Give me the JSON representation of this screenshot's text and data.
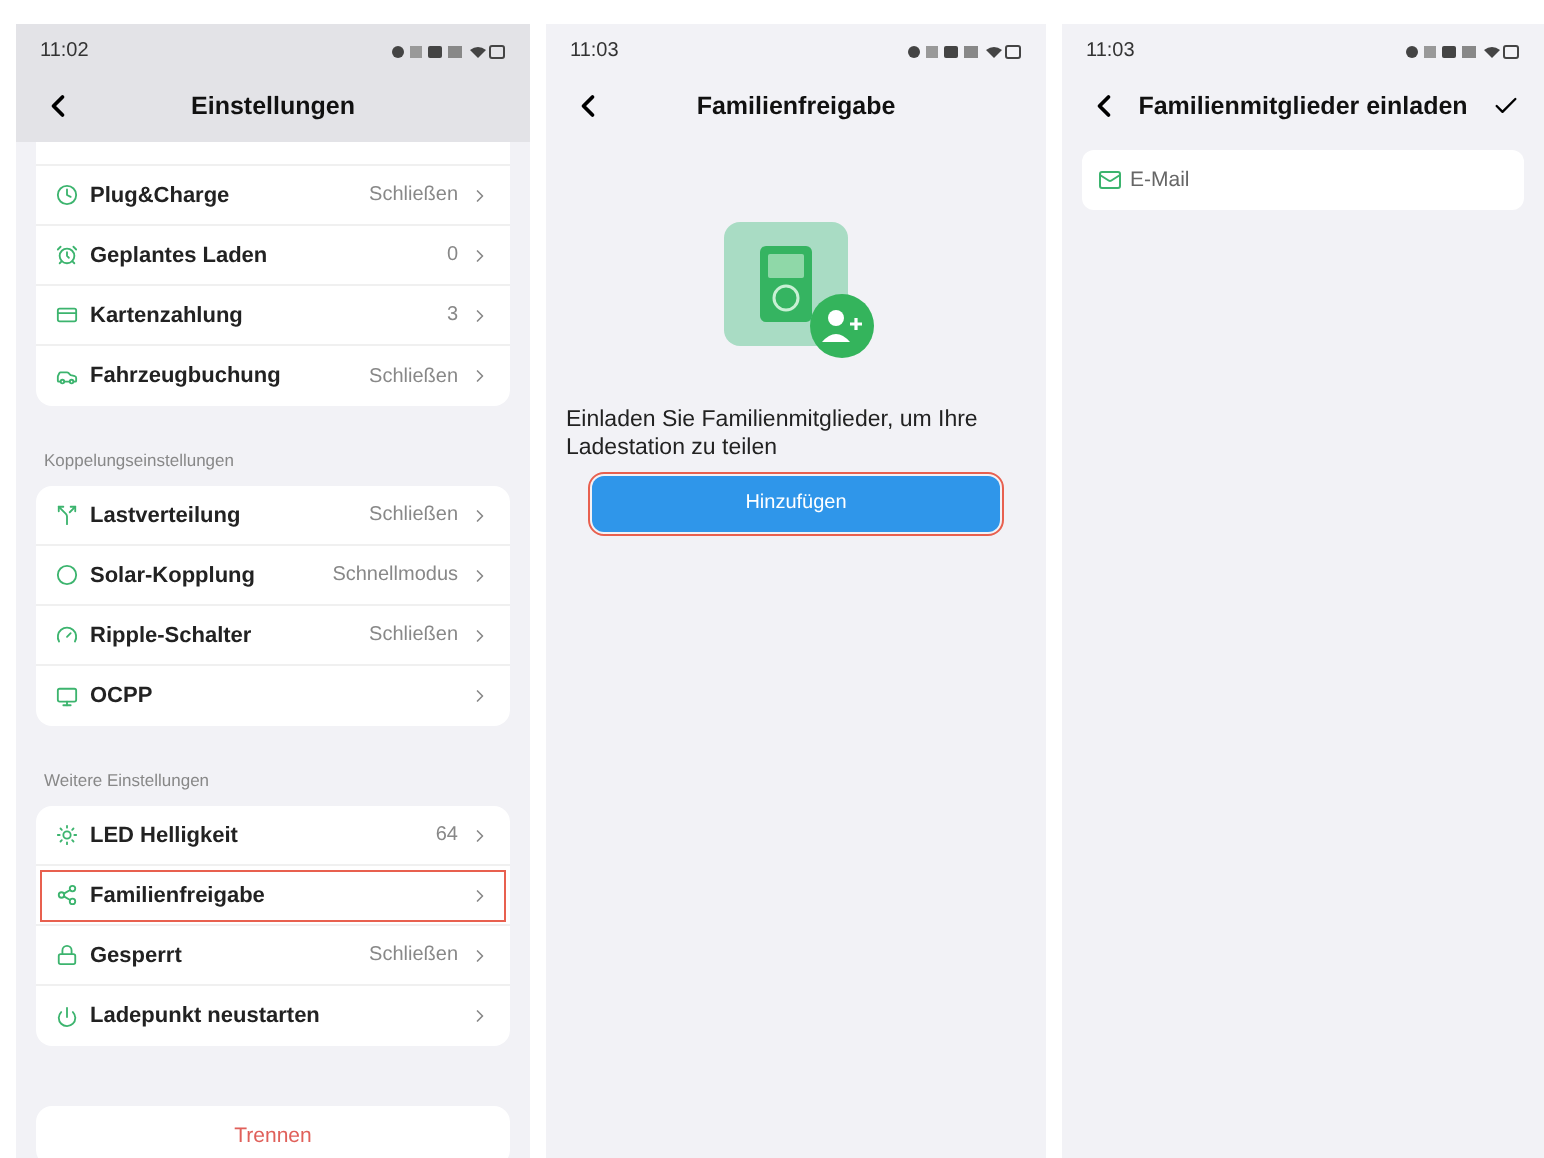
{
  "settings_screen": {
    "status_time": "11:02",
    "title": "Einstellungen",
    "groups": [
      {
        "clipped_top": true,
        "rows": [
          {
            "label": "Plug&Charge",
            "value": "Schließen",
            "highlighted": false
          },
          {
            "label": "Geplantes Laden",
            "value": "0",
            "highlighted": false
          },
          {
            "label": "Kartenzahlung",
            "value": "3",
            "highlighted": false
          },
          {
            "label": "Fahrzeugbuchung",
            "value": "Schließen",
            "highlighted": false
          }
        ]
      },
      {
        "label": "Koppelungseinstellungen",
        "rows": [
          {
            "label": "Lastverteilung",
            "value": "Schließen",
            "highlighted": false
          },
          {
            "label": "Solar-Kopplung",
            "value": "Schnellmodus",
            "highlighted": false
          },
          {
            "label": "Ripple-Schalter",
            "value": "Schließen",
            "highlighted": false
          },
          {
            "label": "OCPP",
            "value": null,
            "highlighted": false
          }
        ]
      },
      {
        "label": "Weitere Einstellungen",
        "rows": [
          {
            "label": "LED Helligkeit",
            "value": "64",
            "highlighted": false
          },
          {
            "label": "Familienfreigabe",
            "value": null,
            "highlighted": true
          },
          {
            "label": "Gesperrt",
            "value": "Schließen",
            "highlighted": false
          },
          {
            "label": "Ladepunkt neustarten",
            "value": null,
            "highlighted": false
          }
        ]
      }
    ],
    "disconnect_button": "Trennen"
  },
  "sharing_screen": {
    "status_time": "11:03",
    "title": "Familienfreigabe",
    "message": "Einladen Sie Familienmitglieder, um Ihre Ladestation zu teilen",
    "add_button": {
      "label": "Hinzufügen",
      "highlighted": true
    }
  },
  "invite_screen": {
    "status_time": "11:03",
    "title": "Familienmitglieder einladen",
    "email_field": {
      "placeholder": "E-Mail"
    }
  }
}
